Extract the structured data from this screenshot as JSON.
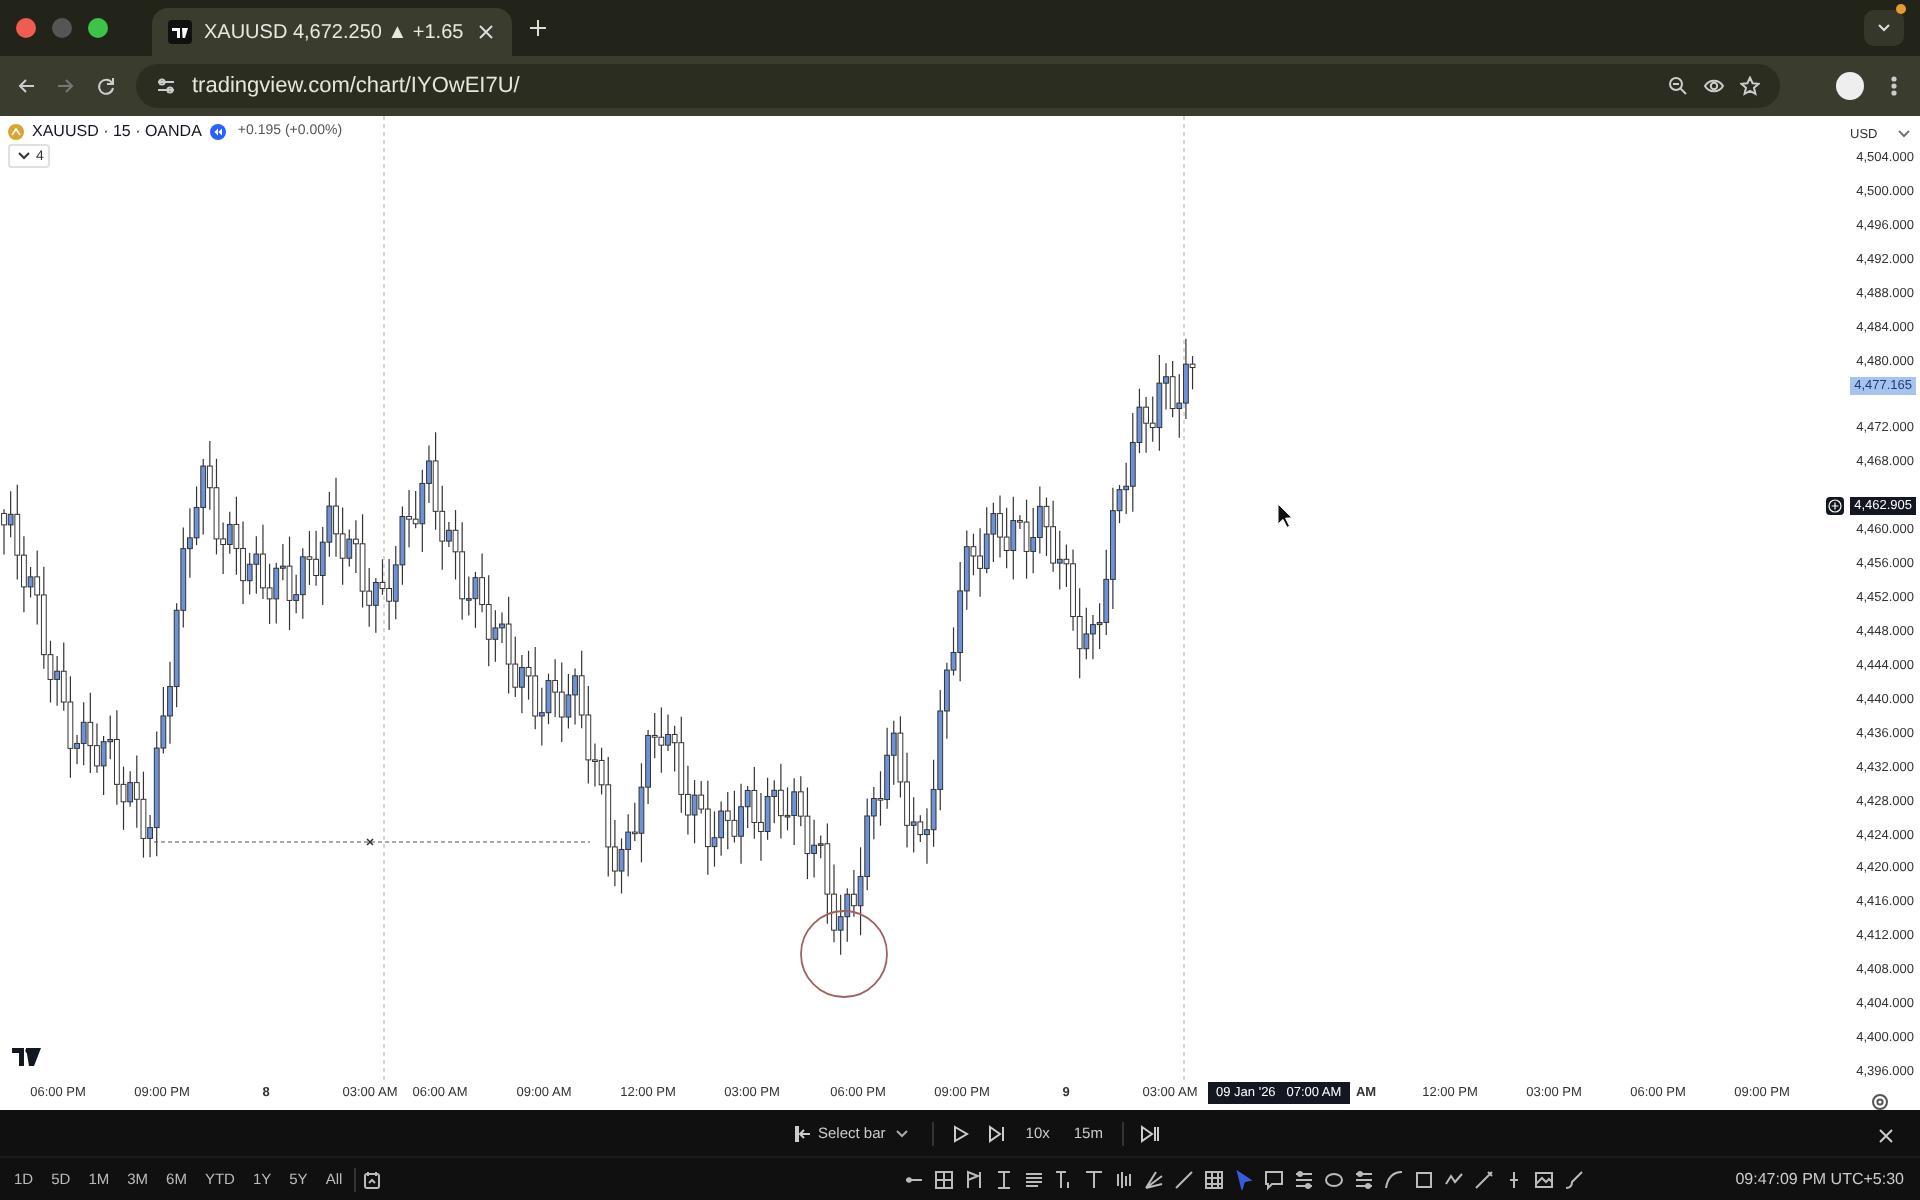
{
  "browser": {
    "tabs": [
      {
        "title": "XAUUSD 4,672.250 ▲ +1.65",
        "selected": true
      }
    ],
    "url": "tradingview.com/chart/IYOwEI7U/"
  },
  "chart": {
    "symbol": "XAUUSD · 15 · OANDA",
    "change": "+0.195 (+0.00%)",
    "indicator_count": "4",
    "currency": "USD",
    "price_ticks": [
      "4,504.000",
      "4,500.000",
      "4,496.000",
      "4,492.000",
      "4,488.000",
      "4,484.000",
      "4,480.000",
      "4,472.000",
      "4,468.000",
      "4,460.000",
      "4,456.000",
      "4,452.000",
      "4,448.000",
      "4,444.000",
      "4,440.000",
      "4,436.000",
      "4,432.000",
      "4,428.000",
      "4,424.000",
      "4,420.000",
      "4,416.000",
      "4,412.000",
      "4,408.000",
      "4,404.000",
      "4,400.000",
      "4,396.000"
    ],
    "price_badges": [
      {
        "kind": "last",
        "text": "4,477.165"
      },
      {
        "kind": "crosshair",
        "text": "4,462.905"
      }
    ],
    "time_ticks": [
      "06:00 PM",
      "09:00 PM",
      "8",
      "03:00 AM",
      "06:00 AM",
      "09:00 AM",
      "12:00 PM",
      "03:00 PM",
      "06:00 PM",
      "09:00 PM",
      "9",
      "03:00 AM",
      "AM",
      "12:00 PM",
      "03:00 PM",
      "06:00 PM",
      "09:00 PM"
    ],
    "crosshair_time": "09 Jan '26   07:00 AM"
  },
  "replay": {
    "mode": "Select bar",
    "speed": "10x",
    "interval": "15m"
  },
  "ranges": [
    "1D",
    "5D",
    "1M",
    "3M",
    "6M",
    "YTD",
    "1Y",
    "5Y",
    "All"
  ],
  "clock": "09:47:09 PM UTC+5:30"
}
